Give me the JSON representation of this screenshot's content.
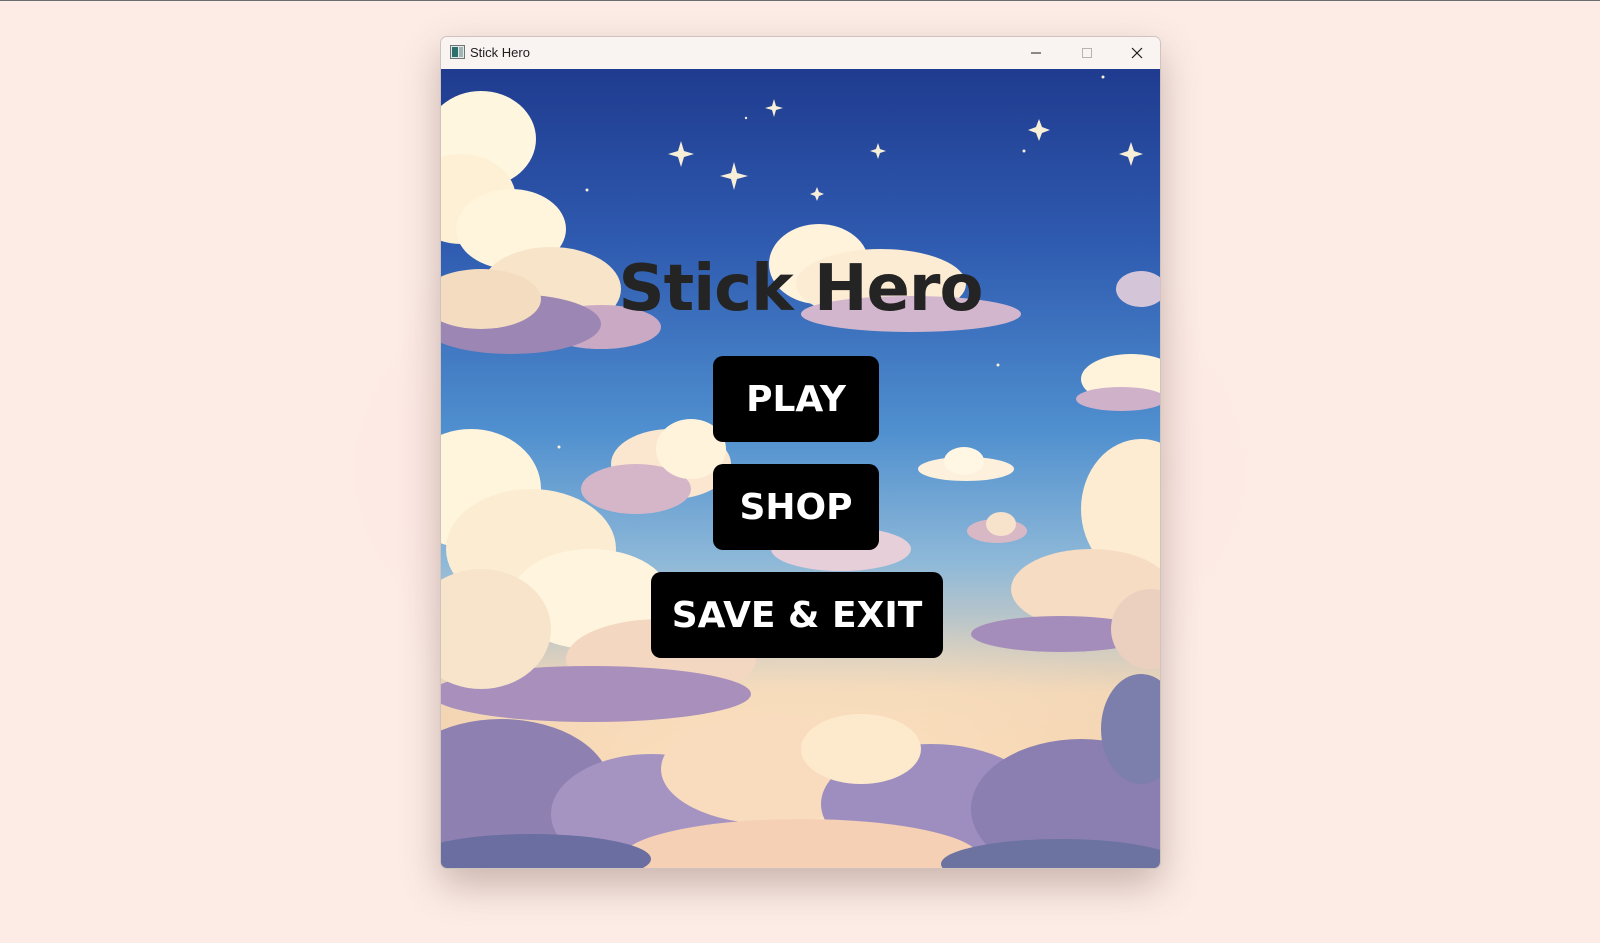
{
  "window": {
    "title": "Stick Hero",
    "app_icon": "app-window-icon",
    "controls": [
      "minimize-icon",
      "maximize-icon",
      "close-icon"
    ]
  },
  "game": {
    "title": "Stick Hero",
    "buttons": {
      "play": "PLAY",
      "shop": "SHOP",
      "save_exit": "SAVE & EXIT"
    }
  },
  "colors": {
    "desktop_background": "#fdece6",
    "title_text": "#242424",
    "button_background": "#000000",
    "button_text": "#ffffff",
    "sky_top": "#1f3b8f",
    "sky_horizon": "#f6d2ae"
  }
}
